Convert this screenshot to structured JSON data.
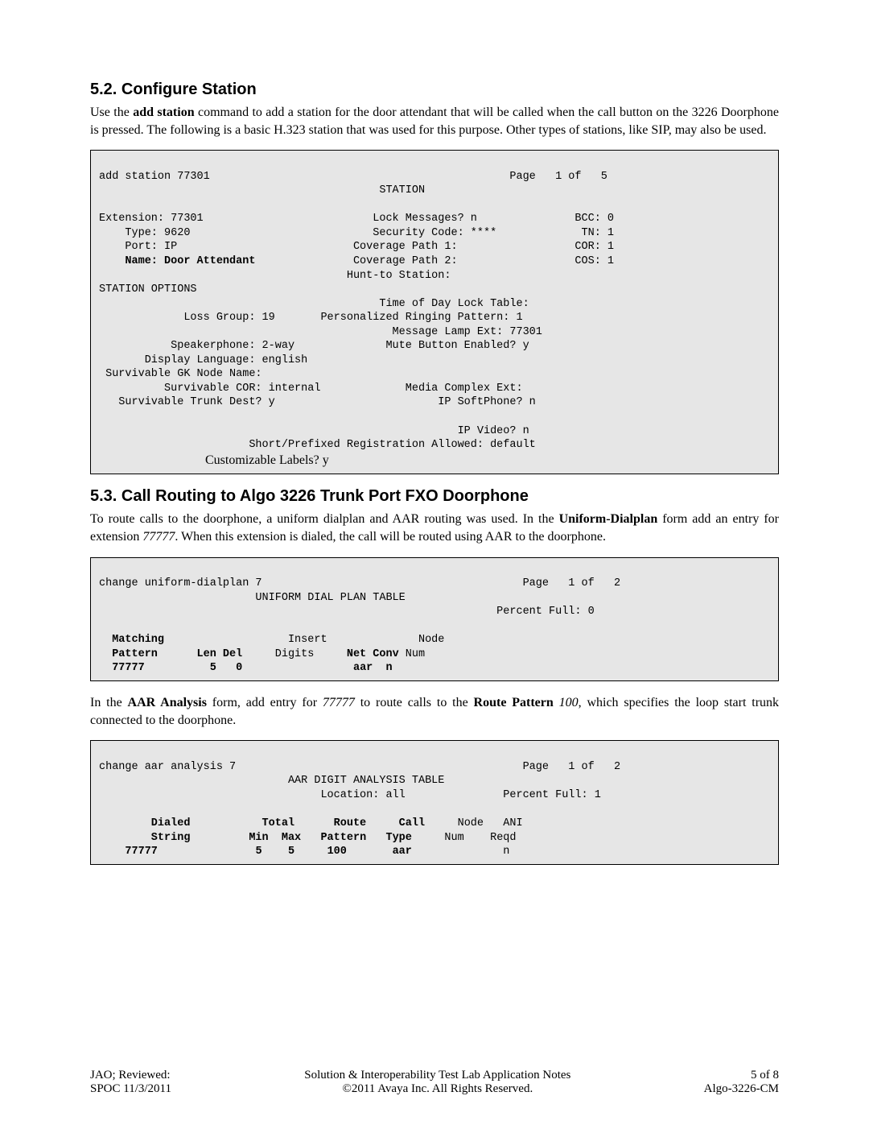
{
  "doc": {
    "s52": {
      "heading_number": "5.2.",
      "heading_text": "Configure Station",
      "intro_pre": "Use the ",
      "cmd": "add station",
      "intro_post": " command to add a station for the door attendant that will be called when the call button on the 3226 Doorphone is pressed.  The following is a basic H.323 station that was used for this purpose.  Other types of stations, like SIP, may also be used.",
      "code_line1": "add station 77301                                              Page   1 of   5",
      "code_line2": "                                           STATION",
      "code_line3": "",
      "code_line4": "Extension: 77301                          Lock Messages? n               BCC: 0",
      "code_line5": "    Type: 9620                            Security Code: ****             TN: 1",
      "code_line6": "    Port: IP                           Coverage Path 1:                  COR: 1",
      "code_name_label": "    Name: Door Attendant",
      "code_line7a": "               Coverage Path 2:                  COS: 1",
      "code_line7b": "                                      Hunt-to Station:",
      "code_line8": "STATION OPTIONS",
      "code_line9": "                                           Time of Day Lock Table:",
      "code_line10": "             Loss Group: 19       Personalized Ringing Pattern: 1",
      "code_line11": "                                             Message Lamp Ext: 77301",
      "code_line12": "           Speakerphone: 2-way              Mute Button Enabled? y",
      "code_line13": "       Display Language: english",
      "code_line14": " Survivable GK Node Name:",
      "code_line15": "          Survivable COR: internal             Media Complex Ext:",
      "code_line16": "   Survivable Trunk Dest? y                         IP SoftPhone? n",
      "code_line17": "",
      "code_line18": "                                                       IP Video? n",
      "code_line19": "                       Short/Prefixed Registration Allowed: default",
      "code_trailing": "                                 Customizable Labels? y"
    },
    "s53": {
      "heading_number": "5.3.",
      "heading_text": "Call Routing to Algo 3226 Trunk Port FXO Doorphone",
      "p1_pre": "To route calls to the doorphone, a uniform dialplan and AAR routing was used.  In the ",
      "p1_bold": "Uniform-Dialplan",
      "p1_mid": " form add an entry for extension ",
      "p1_italic": "77777",
      "p1_post": ".  When this extension is dialed, the call will be routed using AAR to the doorphone.",
      "code1_l1": "change uniform-dialplan 7                                        Page   1 of   2",
      "code1_l2": "                        UNIFORM DIAL PLAN TABLE",
      "code1_l3": "                                                             Percent Full: 0",
      "code1_l4": "",
      "code1_h1": "  Matching",
      "code1_h1b": "                   Insert              Node",
      "code1_h2": "  Pattern      Len Del",
      "code1_h2b": "     Digits     ",
      "code1_h2c": "Net Conv ",
      "code1_h2d": "Num",
      "code1_r1": "  77777          5   0",
      "code1_r1b": "                 ",
      "code1_r1c": "aar  n",
      "p2_pre": "In the ",
      "p2_bold1": "AAR Analysis",
      "p2_mid1": " form, add entry for ",
      "p2_italic1": "77777",
      "p2_mid2": " to route calls to the ",
      "p2_bold2": "Route Pattern",
      "p2_space": " ",
      "p2_italic2": "100",
      "p2_post": ", which specifies the loop start trunk connected to the doorphone.",
      "code2_l1": "change aar analysis 7                                            Page   1 of   2",
      "code2_l2": "                             AAR DIGIT ANALYSIS TABLE",
      "code2_l3": "                                  Location: all               Percent Full: 1",
      "code2_l4": "",
      "code2_h1a": "        Dialed",
      "code2_h1b": "           Total",
      "code2_h1c": "      Route",
      "code2_h1d": "     Call",
      "code2_h1e": "     Node   ANI",
      "code2_h2a": "        String",
      "code2_h2b": "         Min  Max",
      "code2_h2c": "   Pattern",
      "code2_h2d": "   Type",
      "code2_h2e": "     Num    Reqd",
      "code2_r1a": "    77777",
      "code2_r1b": "               5    5",
      "code2_r1c": "     100",
      "code2_r1d": "       aar",
      "code2_r1e": "              n"
    }
  },
  "footer": {
    "left1": "JAO; Reviewed:",
    "left2": "SPOC 11/3/2011",
    "center1": "Solution & Interoperability Test Lab Application Notes",
    "center2": "©2011 Avaya Inc. All Rights Reserved.",
    "right1": "5 of 8",
    "right2": "Algo-3226-CM"
  }
}
